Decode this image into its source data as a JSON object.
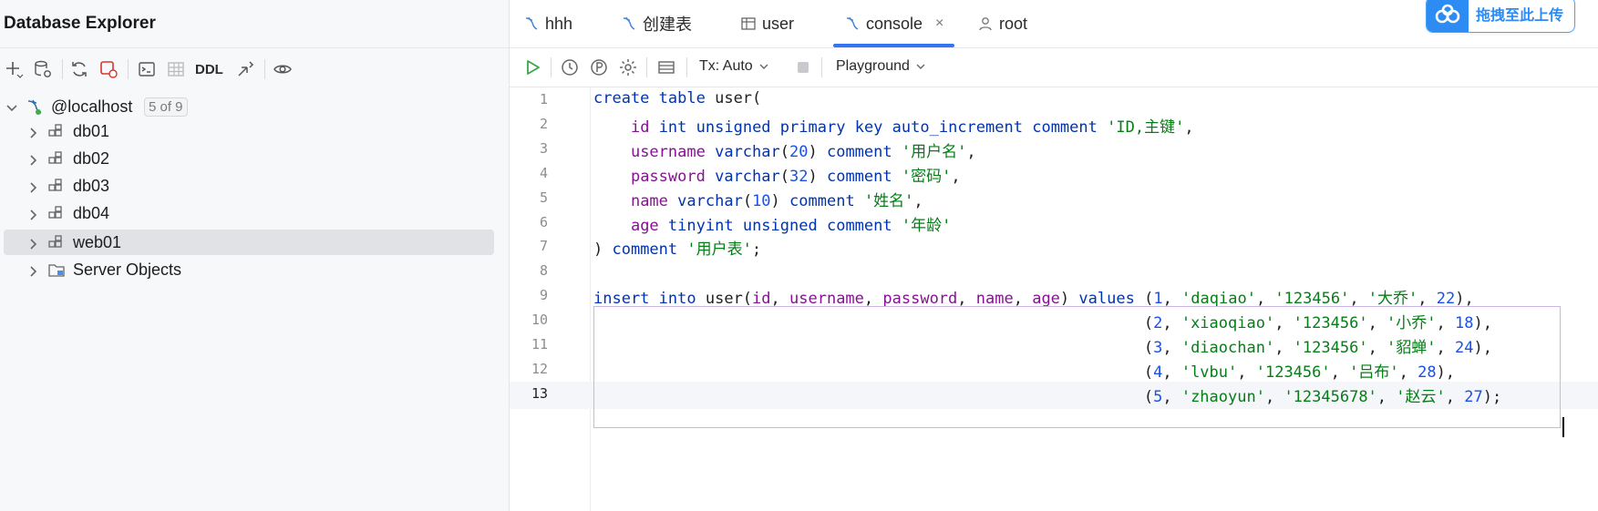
{
  "left_panel": {
    "title": "Database Explorer",
    "toolbar": {
      "icons": [
        "add-icon",
        "datasource-properties-icon",
        "refresh-icon",
        "disconnect-icon",
        "console-icon",
        "table-icon",
        "ddl",
        "jump-to-source-icon",
        "view-options-icon"
      ],
      "ddl_label": "DDL"
    },
    "tree": {
      "root": {
        "label": "@localhost",
        "badge": "5 of 9"
      },
      "items": [
        {
          "label": "db01"
        },
        {
          "label": "db02"
        },
        {
          "label": "db03"
        },
        {
          "label": "db04"
        },
        {
          "label": "web01",
          "selected": true
        },
        {
          "label": "Server Objects"
        }
      ]
    }
  },
  "tabs": [
    {
      "label": "hhh",
      "icon": "sql-file-icon"
    },
    {
      "label": "创建表",
      "icon": "sql-file-icon"
    },
    {
      "label": "user",
      "icon": "table-icon"
    },
    {
      "label": "console",
      "icon": "sql-file-icon",
      "active": true,
      "close": "×"
    },
    {
      "label": "root",
      "icon": "user-icon"
    }
  ],
  "upload_button": {
    "label": "拖拽至此上传"
  },
  "editor_toolbar": {
    "tx_label": "Tx: Auto",
    "playground_label": "Playground"
  },
  "editor": {
    "current_line": 13,
    "lines": [
      {
        "n": "1",
        "text": "create table user("
      },
      {
        "n": "2",
        "text": "    id int unsigned primary key auto_increment comment 'ID,主键',"
      },
      {
        "n": "3",
        "text": "    username varchar(20) comment '用户名',"
      },
      {
        "n": "4",
        "text": "    password varchar(32) comment '密码',"
      },
      {
        "n": "5",
        "text": "    name varchar(10) comment '姓名',"
      },
      {
        "n": "6",
        "text": "    age tinyint unsigned comment '年龄'"
      },
      {
        "n": "7",
        "text": ") comment '用户表';"
      },
      {
        "n": "8",
        "text": ""
      },
      {
        "n": "9",
        "text": "insert into user(id, username, password, name, age) values (1, 'daqiao', '123456', '大乔', 22),"
      },
      {
        "n": "10",
        "text": "                                                           (2, 'xiaoqiao', '123456', '小乔', 18),"
      },
      {
        "n": "11",
        "text": "                                                           (3, 'diaochan', '123456', '貂蝉', 24),"
      },
      {
        "n": "12",
        "text": "                                                           (4, 'lvbu', '123456', '吕布', 28),"
      },
      {
        "n": "13",
        "text": "                                                           (5, 'zhaoyun', '12345678', '赵云', 27);"
      }
    ]
  },
  "colors": {
    "keyword": "#0033b3",
    "column": "#871094",
    "string": "#067d17",
    "number": "#1750eb",
    "accent": "#3574f0"
  }
}
